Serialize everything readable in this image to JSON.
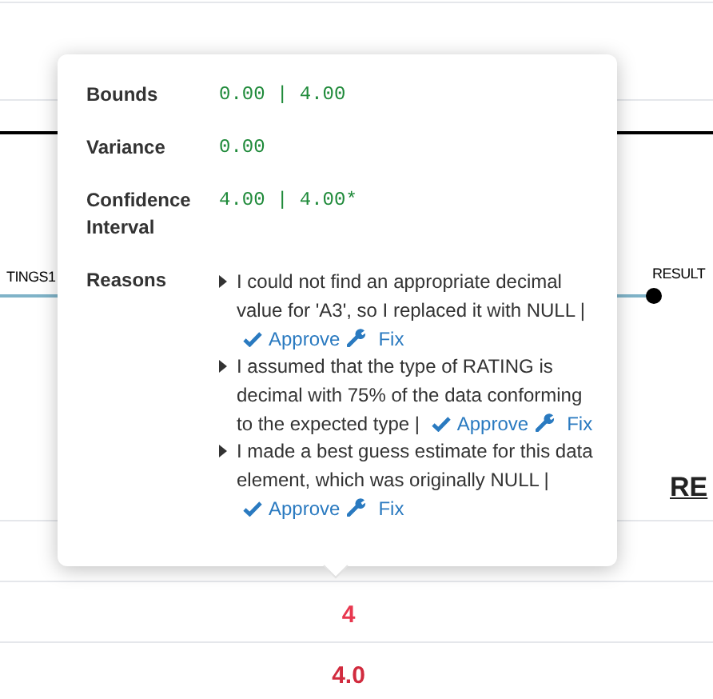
{
  "background": {
    "left_node": "TINGS1",
    "right_node": "RESULT",
    "link": "RE",
    "cells": [
      "4",
      "4.0"
    ]
  },
  "popover": {
    "rows": [
      {
        "label": "Bounds",
        "kind": "value",
        "value": "0.00 | 4.00"
      },
      {
        "label": "Variance",
        "kind": "value",
        "value": "0.00"
      },
      {
        "label": "Confidence Interval",
        "kind": "value",
        "value": "4.00 | 4.00*"
      },
      {
        "label": "Reasons",
        "kind": "reasons",
        "reasons": [
          {
            "text": "I could not find an appropriate decimal value for 'A3', so I replaced it with NULL |",
            "actions": [
              "Approve",
              "Fix"
            ]
          },
          {
            "text": "I assumed that the type of RATING is decimal with 75% of the data conforming to the expected type |",
            "actions": [
              "Approve",
              "Fix"
            ]
          },
          {
            "text": "I made a best guess estimate for this data element, which was originally NULL |",
            "actions": [
              "Approve",
              "Fix"
            ]
          }
        ]
      }
    ]
  }
}
